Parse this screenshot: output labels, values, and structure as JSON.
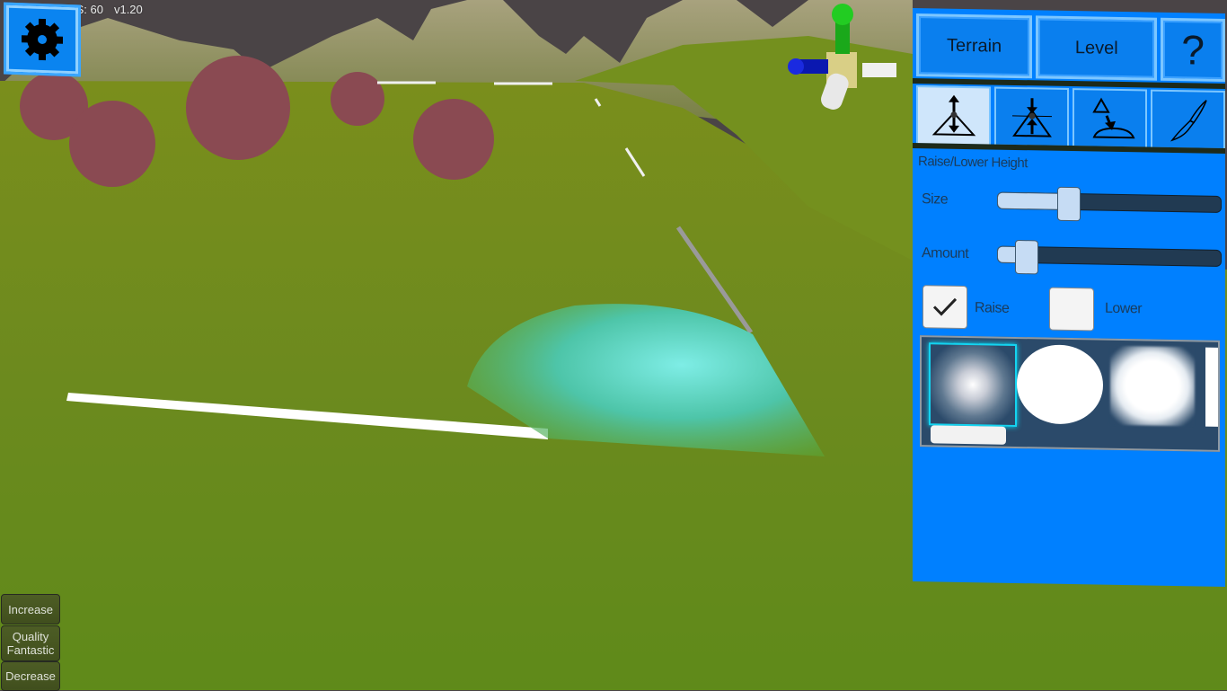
{
  "hud": {
    "fps_label": "FPS: 60",
    "version": "v1.20"
  },
  "settings_button": {
    "icon": "gear-icon"
  },
  "panel": {
    "tabs": [
      {
        "label": "Terrain"
      },
      {
        "label": "Level"
      },
      {
        "label": "?"
      }
    ],
    "tools": [
      {
        "name": "raise-lower-height",
        "icon": "raise-lower-icon",
        "active": true
      },
      {
        "name": "flatten",
        "icon": "flatten-icon",
        "active": false
      },
      {
        "name": "smooth",
        "icon": "smooth-icon",
        "active": false
      },
      {
        "name": "paint",
        "icon": "paintbrush-icon",
        "active": false
      }
    ],
    "section_title": "Raise/Lower Height",
    "size": {
      "label": "Size",
      "value": 0.32
    },
    "amount": {
      "label": "Amount",
      "value": 0.13
    },
    "raise": {
      "label": "Raise",
      "checked": true
    },
    "lower": {
      "label": "Lower",
      "checked": false
    },
    "brushes": [
      {
        "name": "soft-round",
        "selected": true
      },
      {
        "name": "hard-round",
        "selected": false
      },
      {
        "name": "soft-square",
        "selected": false
      }
    ]
  },
  "quality": {
    "increase_label": "Increase",
    "quality_line1": "Quality",
    "quality_line2": "Fantastic",
    "decrease_label": "Decrease"
  },
  "colors": {
    "panel_blue": "#0080ff",
    "brush_bg": "#2b4a6a",
    "grass": "#6e8a1e",
    "sky": "#4a4446"
  }
}
